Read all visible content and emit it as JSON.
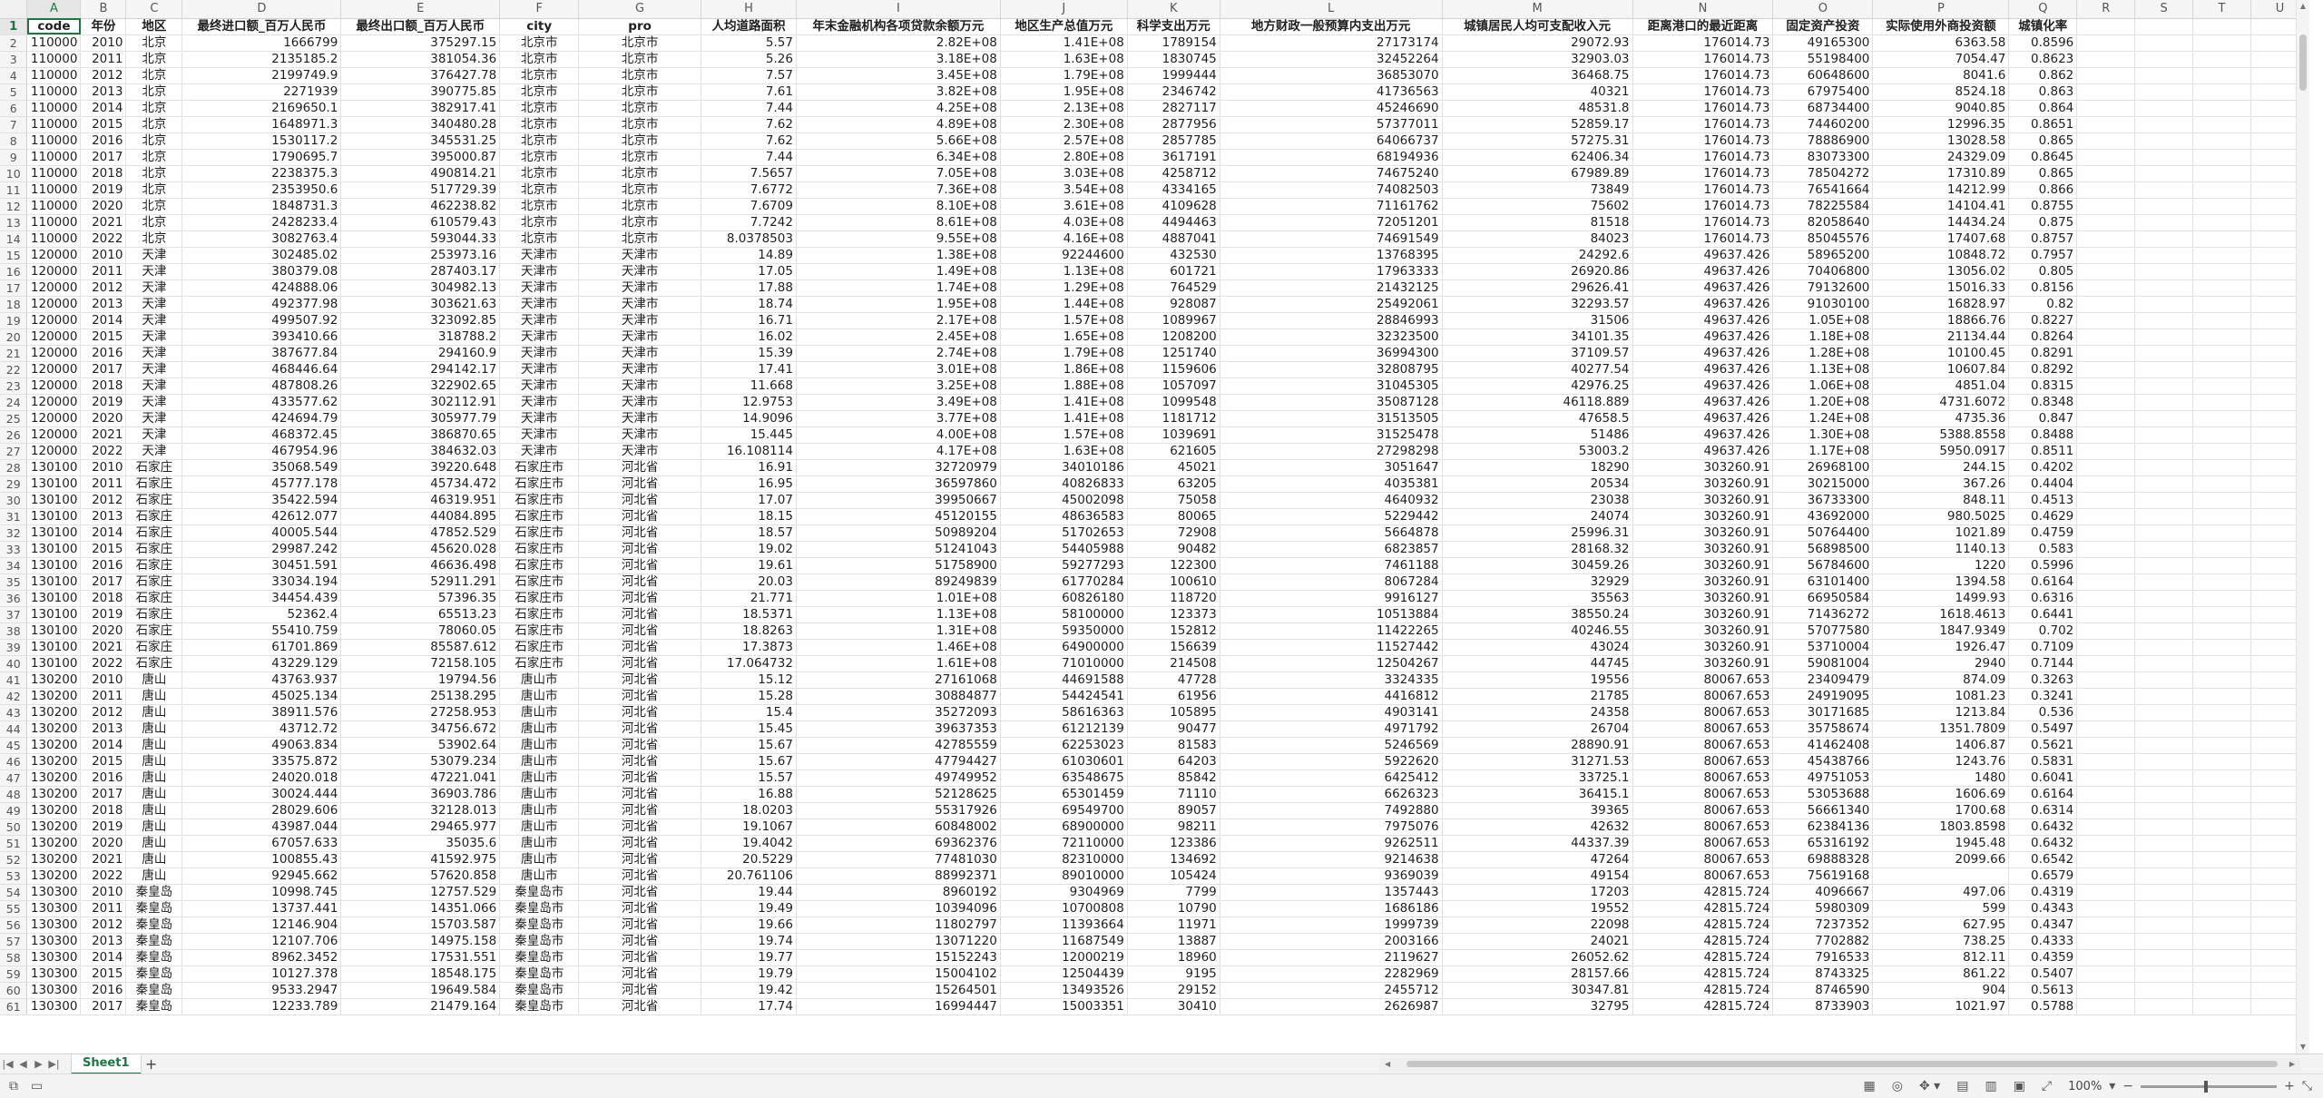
{
  "columns": [
    "A",
    "B",
    "C",
    "D",
    "E",
    "F",
    "G",
    "H",
    "I",
    "J",
    "K",
    "L",
    "M",
    "N",
    "O",
    "P",
    "Q",
    "R",
    "S",
    "T",
    "U"
  ],
  "col_widths": [
    59,
    50,
    62,
    175,
    175,
    87,
    135,
    105,
    225,
    140,
    102,
    245,
    210,
    155,
    110,
    150,
    75,
    64,
    64,
    64,
    64
  ],
  "num_cols": [
    0,
    1,
    3,
    4,
    7,
    8,
    9,
    10,
    11,
    12,
    13,
    14,
    15,
    16
  ],
  "center_cols": [
    2,
    5,
    6
  ],
  "headers": [
    "code",
    "年份",
    "地区",
    "最终进口额_百万人民币",
    "最终出口额_百万人民币",
    "city",
    "pro",
    "人均道路面积",
    "年末金融机构各项贷款余额万元",
    "地区生产总值万元",
    "科学支出万元",
    "地方财政一般预算内支出万元",
    "城镇居民人均可支配收入元",
    "距离港口的最近距离",
    "固定资产投资",
    "实际使用外商投资额",
    "城镇化率",
    "",
    "",
    "",
    ""
  ],
  "rows": [
    [
      "110000",
      "2010",
      "北京",
      "1666799",
      "375297.15",
      "北京市",
      "北京市",
      "5.57",
      "2.82E+08",
      "1.41E+08",
      "1789154",
      "27173174",
      "29072.93",
      "176014.73",
      "49165300",
      "6363.58",
      "0.8596"
    ],
    [
      "110000",
      "2011",
      "北京",
      "2135185.2",
      "381054.36",
      "北京市",
      "北京市",
      "5.26",
      "3.18E+08",
      "1.63E+08",
      "1830745",
      "32452264",
      "32903.03",
      "176014.73",
      "55198400",
      "7054.47",
      "0.8623"
    ],
    [
      "110000",
      "2012",
      "北京",
      "2199749.9",
      "376427.78",
      "北京市",
      "北京市",
      "7.57",
      "3.45E+08",
      "1.79E+08",
      "1999444",
      "36853070",
      "36468.75",
      "176014.73",
      "60648600",
      "8041.6",
      "0.862"
    ],
    [
      "110000",
      "2013",
      "北京",
      "2271939",
      "390775.85",
      "北京市",
      "北京市",
      "7.61",
      "3.82E+08",
      "1.95E+08",
      "2346742",
      "41736563",
      "40321",
      "176014.73",
      "67975400",
      "8524.18",
      "0.863"
    ],
    [
      "110000",
      "2014",
      "北京",
      "2169650.1",
      "382917.41",
      "北京市",
      "北京市",
      "7.44",
      "4.25E+08",
      "2.13E+08",
      "2827117",
      "45246690",
      "48531.8",
      "176014.73",
      "68734400",
      "9040.85",
      "0.864"
    ],
    [
      "110000",
      "2015",
      "北京",
      "1648971.3",
      "340480.28",
      "北京市",
      "北京市",
      "7.62",
      "4.89E+08",
      "2.30E+08",
      "2877956",
      "57377011",
      "52859.17",
      "176014.73",
      "74460200",
      "12996.35",
      "0.8651"
    ],
    [
      "110000",
      "2016",
      "北京",
      "1530117.2",
      "345531.25",
      "北京市",
      "北京市",
      "7.62",
      "5.66E+08",
      "2.57E+08",
      "2857785",
      "64066737",
      "57275.31",
      "176014.73",
      "78886900",
      "13028.58",
      "0.865"
    ],
    [
      "110000",
      "2017",
      "北京",
      "1790695.7",
      "395000.87",
      "北京市",
      "北京市",
      "7.44",
      "6.34E+08",
      "2.80E+08",
      "3617191",
      "68194936",
      "62406.34",
      "176014.73",
      "83073300",
      "24329.09",
      "0.8645"
    ],
    [
      "110000",
      "2018",
      "北京",
      "2238375.3",
      "490814.21",
      "北京市",
      "北京市",
      "7.5657",
      "7.05E+08",
      "3.03E+08",
      "4258712",
      "74675240",
      "67989.89",
      "176014.73",
      "78504272",
      "17310.89",
      "0.865"
    ],
    [
      "110000",
      "2019",
      "北京",
      "2353950.6",
      "517729.39",
      "北京市",
      "北京市",
      "7.6772",
      "7.36E+08",
      "3.54E+08",
      "4334165",
      "74082503",
      "73849",
      "176014.73",
      "76541664",
      "14212.99",
      "0.866"
    ],
    [
      "110000",
      "2020",
      "北京",
      "1848731.3",
      "462238.82",
      "北京市",
      "北京市",
      "7.6709",
      "8.10E+08",
      "3.61E+08",
      "4109628",
      "71161762",
      "75602",
      "176014.73",
      "78225584",
      "14104.41",
      "0.8755"
    ],
    [
      "110000",
      "2021",
      "北京",
      "2428233.4",
      "610579.43",
      "北京市",
      "北京市",
      "7.7242",
      "8.61E+08",
      "4.03E+08",
      "4494463",
      "72051201",
      "81518",
      "176014.73",
      "82058640",
      "14434.24",
      "0.875"
    ],
    [
      "110000",
      "2022",
      "北京",
      "3082763.4",
      "593044.33",
      "北京市",
      "北京市",
      "8.0378503",
      "9.55E+08",
      "4.16E+08",
      "4887041",
      "74691549",
      "84023",
      "176014.73",
      "85045576",
      "17407.68",
      "0.8757"
    ],
    [
      "120000",
      "2010",
      "天津",
      "302485.02",
      "253973.16",
      "天津市",
      "天津市",
      "14.89",
      "1.38E+08",
      "92244600",
      "432530",
      "13768395",
      "24292.6",
      "49637.426",
      "58965200",
      "10848.72",
      "0.7957"
    ],
    [
      "120000",
      "2011",
      "天津",
      "380379.08",
      "287403.17",
      "天津市",
      "天津市",
      "17.05",
      "1.49E+08",
      "1.13E+08",
      "601721",
      "17963333",
      "26920.86",
      "49637.426",
      "70406800",
      "13056.02",
      "0.805"
    ],
    [
      "120000",
      "2012",
      "天津",
      "424888.06",
      "304982.13",
      "天津市",
      "天津市",
      "17.88",
      "1.74E+08",
      "1.29E+08",
      "764529",
      "21432125",
      "29626.41",
      "49637.426",
      "79132600",
      "15016.33",
      "0.8156"
    ],
    [
      "120000",
      "2013",
      "天津",
      "492377.98",
      "303621.63",
      "天津市",
      "天津市",
      "18.74",
      "1.95E+08",
      "1.44E+08",
      "928087",
      "25492061",
      "32293.57",
      "49637.426",
      "91030100",
      "16828.97",
      "0.82"
    ],
    [
      "120000",
      "2014",
      "天津",
      "499507.92",
      "323092.85",
      "天津市",
      "天津市",
      "16.71",
      "2.17E+08",
      "1.57E+08",
      "1089967",
      "28846993",
      "31506",
      "49637.426",
      "1.05E+08",
      "18866.76",
      "0.8227"
    ],
    [
      "120000",
      "2015",
      "天津",
      "393410.66",
      "318788.2",
      "天津市",
      "天津市",
      "16.02",
      "2.45E+08",
      "1.65E+08",
      "1208200",
      "32323500",
      "34101.35",
      "49637.426",
      "1.18E+08",
      "21134.44",
      "0.8264"
    ],
    [
      "120000",
      "2016",
      "天津",
      "387677.84",
      "294160.9",
      "天津市",
      "天津市",
      "15.39",
      "2.74E+08",
      "1.79E+08",
      "1251740",
      "36994300",
      "37109.57",
      "49637.426",
      "1.28E+08",
      "10100.45",
      "0.8291"
    ],
    [
      "120000",
      "2017",
      "天津",
      "468446.64",
      "294142.17",
      "天津市",
      "天津市",
      "17.41",
      "3.01E+08",
      "1.86E+08",
      "1159606",
      "32808795",
      "40277.54",
      "49637.426",
      "1.13E+08",
      "10607.84",
      "0.8292"
    ],
    [
      "120000",
      "2018",
      "天津",
      "487808.26",
      "322902.65",
      "天津市",
      "天津市",
      "11.668",
      "3.25E+08",
      "1.88E+08",
      "1057097",
      "31045305",
      "42976.25",
      "49637.426",
      "1.06E+08",
      "4851.04",
      "0.8315"
    ],
    [
      "120000",
      "2019",
      "天津",
      "433577.62",
      "302112.91",
      "天津市",
      "天津市",
      "12.9753",
      "3.49E+08",
      "1.41E+08",
      "1099548",
      "35087128",
      "46118.889",
      "49637.426",
      "1.20E+08",
      "4731.6072",
      "0.8348"
    ],
    [
      "120000",
      "2020",
      "天津",
      "424694.79",
      "305977.79",
      "天津市",
      "天津市",
      "14.9096",
      "3.77E+08",
      "1.41E+08",
      "1181712",
      "31513505",
      "47658.5",
      "49637.426",
      "1.24E+08",
      "4735.36",
      "0.847"
    ],
    [
      "120000",
      "2021",
      "天津",
      "468372.45",
      "386870.65",
      "天津市",
      "天津市",
      "15.445",
      "4.00E+08",
      "1.57E+08",
      "1039691",
      "31525478",
      "51486",
      "49637.426",
      "1.30E+08",
      "5388.8558",
      "0.8488"
    ],
    [
      "120000",
      "2022",
      "天津",
      "467954.96",
      "384632.03",
      "天津市",
      "天津市",
      "16.108114",
      "4.17E+08",
      "1.63E+08",
      "621605",
      "27298298",
      "53003.2",
      "49637.426",
      "1.17E+08",
      "5950.0917",
      "0.8511"
    ],
    [
      "130100",
      "2010",
      "石家庄",
      "35068.549",
      "39220.648",
      "石家庄市",
      "河北省",
      "16.91",
      "32720979",
      "34010186",
      "45021",
      "3051647",
      "18290",
      "303260.91",
      "26968100",
      "244.15",
      "0.4202"
    ],
    [
      "130100",
      "2011",
      "石家庄",
      "45777.178",
      "45734.472",
      "石家庄市",
      "河北省",
      "16.95",
      "36597860",
      "40826833",
      "63205",
      "4035381",
      "20534",
      "303260.91",
      "30215000",
      "367.26",
      "0.4404"
    ],
    [
      "130100",
      "2012",
      "石家庄",
      "35422.594",
      "46319.951",
      "石家庄市",
      "河北省",
      "17.07",
      "39950667",
      "45002098",
      "75058",
      "4640932",
      "23038",
      "303260.91",
      "36733300",
      "848.11",
      "0.4513"
    ],
    [
      "130100",
      "2013",
      "石家庄",
      "42612.077",
      "44084.895",
      "石家庄市",
      "河北省",
      "18.15",
      "45120155",
      "48636583",
      "80065",
      "5229442",
      "24074",
      "303260.91",
      "43692000",
      "980.5025",
      "0.4629"
    ],
    [
      "130100",
      "2014",
      "石家庄",
      "40005.544",
      "47852.529",
      "石家庄市",
      "河北省",
      "18.57",
      "50989204",
      "51702653",
      "72908",
      "5664878",
      "25996.31",
      "303260.91",
      "50764400",
      "1021.89",
      "0.4759"
    ],
    [
      "130100",
      "2015",
      "石家庄",
      "29987.242",
      "45620.028",
      "石家庄市",
      "河北省",
      "19.02",
      "51241043",
      "54405988",
      "90482",
      "6823857",
      "28168.32",
      "303260.91",
      "56898500",
      "1140.13",
      "0.583"
    ],
    [
      "130100",
      "2016",
      "石家庄",
      "30451.591",
      "46636.498",
      "石家庄市",
      "河北省",
      "19.61",
      "51758900",
      "59277293",
      "122300",
      "7461188",
      "30459.26",
      "303260.91",
      "56784600",
      "1220",
      "0.5996"
    ],
    [
      "130100",
      "2017",
      "石家庄",
      "33034.194",
      "52911.291",
      "石家庄市",
      "河北省",
      "20.03",
      "89249839",
      "61770284",
      "100610",
      "8067284",
      "32929",
      "303260.91",
      "63101400",
      "1394.58",
      "0.6164"
    ],
    [
      "130100",
      "2018",
      "石家庄",
      "34454.439",
      "57396.35",
      "石家庄市",
      "河北省",
      "21.771",
      "1.01E+08",
      "60826180",
      "118720",
      "9916127",
      "35563",
      "303260.91",
      "66950584",
      "1499.93",
      "0.6316"
    ],
    [
      "130100",
      "2019",
      "石家庄",
      "52362.4",
      "65513.23",
      "石家庄市",
      "河北省",
      "18.5371",
      "1.13E+08",
      "58100000",
      "123373",
      "10513884",
      "38550.24",
      "303260.91",
      "71436272",
      "1618.4613",
      "0.6441"
    ],
    [
      "130100",
      "2020",
      "石家庄",
      "55410.759",
      "78060.05",
      "石家庄市",
      "河北省",
      "18.8263",
      "1.31E+08",
      "59350000",
      "152812",
      "11422265",
      "40246.55",
      "303260.91",
      "57077580",
      "1847.9349",
      "0.702"
    ],
    [
      "130100",
      "2021",
      "石家庄",
      "61701.869",
      "85587.612",
      "石家庄市",
      "河北省",
      "17.3873",
      "1.46E+08",
      "64900000",
      "156639",
      "11527442",
      "43024",
      "303260.91",
      "53710004",
      "1926.47",
      "0.7109"
    ],
    [
      "130100",
      "2022",
      "石家庄",
      "43229.129",
      "72158.105",
      "石家庄市",
      "河北省",
      "17.064732",
      "1.61E+08",
      "71010000",
      "214508",
      "12504267",
      "44745",
      "303260.91",
      "59081004",
      "2940",
      "0.7144"
    ],
    [
      "130200",
      "2010",
      "唐山",
      "43763.937",
      "19794.56",
      "唐山市",
      "河北省",
      "15.12",
      "27161068",
      "44691588",
      "47728",
      "3324335",
      "19556",
      "80067.653",
      "23409479",
      "874.09",
      "0.3263"
    ],
    [
      "130200",
      "2011",
      "唐山",
      "45025.134",
      "25138.295",
      "唐山市",
      "河北省",
      "15.28",
      "30884877",
      "54424541",
      "61956",
      "4416812",
      "21785",
      "80067.653",
      "24919095",
      "1081.23",
      "0.3241"
    ],
    [
      "130200",
      "2012",
      "唐山",
      "38911.576",
      "27258.953",
      "唐山市",
      "河北省",
      "15.4",
      "35272093",
      "58616363",
      "105895",
      "4903141",
      "24358",
      "80067.653",
      "30171685",
      "1213.84",
      "0.536"
    ],
    [
      "130200",
      "2013",
      "唐山",
      "43712.72",
      "34756.672",
      "唐山市",
      "河北省",
      "15.45",
      "39637353",
      "61212139",
      "90477",
      "4971792",
      "26704",
      "80067.653",
      "35758674",
      "1351.7809",
      "0.5497"
    ],
    [
      "130200",
      "2014",
      "唐山",
      "49063.834",
      "53902.64",
      "唐山市",
      "河北省",
      "15.67",
      "42785559",
      "62253023",
      "81583",
      "5246569",
      "28890.91",
      "80067.653",
      "41462408",
      "1406.87",
      "0.5621"
    ],
    [
      "130200",
      "2015",
      "唐山",
      "33575.872",
      "53079.234",
      "唐山市",
      "河北省",
      "15.67",
      "47794427",
      "61030601",
      "64203",
      "5922620",
      "31271.53",
      "80067.653",
      "45438766",
      "1243.76",
      "0.5831"
    ],
    [
      "130200",
      "2016",
      "唐山",
      "24020.018",
      "47221.041",
      "唐山市",
      "河北省",
      "15.57",
      "49749952",
      "63548675",
      "85842",
      "6425412",
      "33725.1",
      "80067.653",
      "49751053",
      "1480",
      "0.6041"
    ],
    [
      "130200",
      "2017",
      "唐山",
      "30024.444",
      "36903.786",
      "唐山市",
      "河北省",
      "16.88",
      "52128625",
      "65301459",
      "71110",
      "6626323",
      "36415.1",
      "80067.653",
      "53053688",
      "1606.69",
      "0.6164"
    ],
    [
      "130200",
      "2018",
      "唐山",
      "28029.606",
      "32128.013",
      "唐山市",
      "河北省",
      "18.0203",
      "55317926",
      "69549700",
      "89057",
      "7492880",
      "39365",
      "80067.653",
      "56661340",
      "1700.68",
      "0.6314"
    ],
    [
      "130200",
      "2019",
      "唐山",
      "43987.044",
      "29465.977",
      "唐山市",
      "河北省",
      "19.1067",
      "60848002",
      "68900000",
      "98211",
      "7975076",
      "42632",
      "80067.653",
      "62384136",
      "1803.8598",
      "0.6432"
    ],
    [
      "130200",
      "2020",
      "唐山",
      "67057.633",
      "35035.6",
      "唐山市",
      "河北省",
      "19.4042",
      "69362376",
      "72110000",
      "123386",
      "9262511",
      "44337.39",
      "80067.653",
      "65316192",
      "1945.48",
      "0.6432"
    ],
    [
      "130200",
      "2021",
      "唐山",
      "100855.43",
      "41592.975",
      "唐山市",
      "河北省",
      "20.5229",
      "77481030",
      "82310000",
      "134692",
      "9214638",
      "47264",
      "80067.653",
      "69888328",
      "2099.66",
      "0.6542"
    ],
    [
      "130200",
      "2022",
      "唐山",
      "92945.662",
      "57620.858",
      "唐山市",
      "河北省",
      "20.761106",
      "88992371",
      "89010000",
      "105424",
      "9369039",
      "49154",
      "80067.653",
      "75619168",
      "",
      "0.6579"
    ],
    [
      "130300",
      "2010",
      "秦皇岛",
      "10998.745",
      "12757.529",
      "秦皇岛市",
      "河北省",
      "19.44",
      "8960192",
      "9304969",
      "7799",
      "1357443",
      "17203",
      "42815.724",
      "4096667",
      "497.06",
      "0.4319"
    ],
    [
      "130300",
      "2011",
      "秦皇岛",
      "13737.441",
      "14351.066",
      "秦皇岛市",
      "河北省",
      "19.49",
      "10394096",
      "10700808",
      "10790",
      "1686186",
      "19552",
      "42815.724",
      "5980309",
      "599",
      "0.4343"
    ],
    [
      "130300",
      "2012",
      "秦皇岛",
      "12146.904",
      "15703.587",
      "秦皇岛市",
      "河北省",
      "19.66",
      "11802797",
      "11393664",
      "11971",
      "1999739",
      "22098",
      "42815.724",
      "7237352",
      "627.95",
      "0.4347"
    ],
    [
      "130300",
      "2013",
      "秦皇岛",
      "12107.706",
      "14975.158",
      "秦皇岛市",
      "河北省",
      "19.74",
      "13071220",
      "11687549",
      "13887",
      "2003166",
      "24021",
      "42815.724",
      "7702882",
      "738.25",
      "0.4333"
    ],
    [
      "130300",
      "2014",
      "秦皇岛",
      "8962.3452",
      "17531.551",
      "秦皇岛市",
      "河北省",
      "19.77",
      "15152243",
      "12000219",
      "18960",
      "2119627",
      "26052.62",
      "42815.724",
      "7916533",
      "812.11",
      "0.4359"
    ],
    [
      "130300",
      "2015",
      "秦皇岛",
      "10127.378",
      "18548.175",
      "秦皇岛市",
      "河北省",
      "19.79",
      "15004102",
      "12504439",
      "9195",
      "2282969",
      "28157.66",
      "42815.724",
      "8743325",
      "861.22",
      "0.5407"
    ],
    [
      "130300",
      "2016",
      "秦皇岛",
      "9533.2947",
      "19649.584",
      "秦皇岛市",
      "河北省",
      "19.42",
      "15264501",
      "13493526",
      "29152",
      "2455712",
      "30347.81",
      "42815.724",
      "8746590",
      "904",
      "0.5613"
    ],
    [
      "130300",
      "2017",
      "秦皇岛",
      "12233.789",
      "21479.164",
      "秦皇岛市",
      "河北省",
      "17.74",
      "16994447",
      "15003351",
      "30410",
      "2626987",
      "32795",
      "42815.724",
      "8733903",
      "1021.97",
      "0.5788"
    ]
  ],
  "sheet_tab": "Sheet1",
  "zoom": "100%"
}
